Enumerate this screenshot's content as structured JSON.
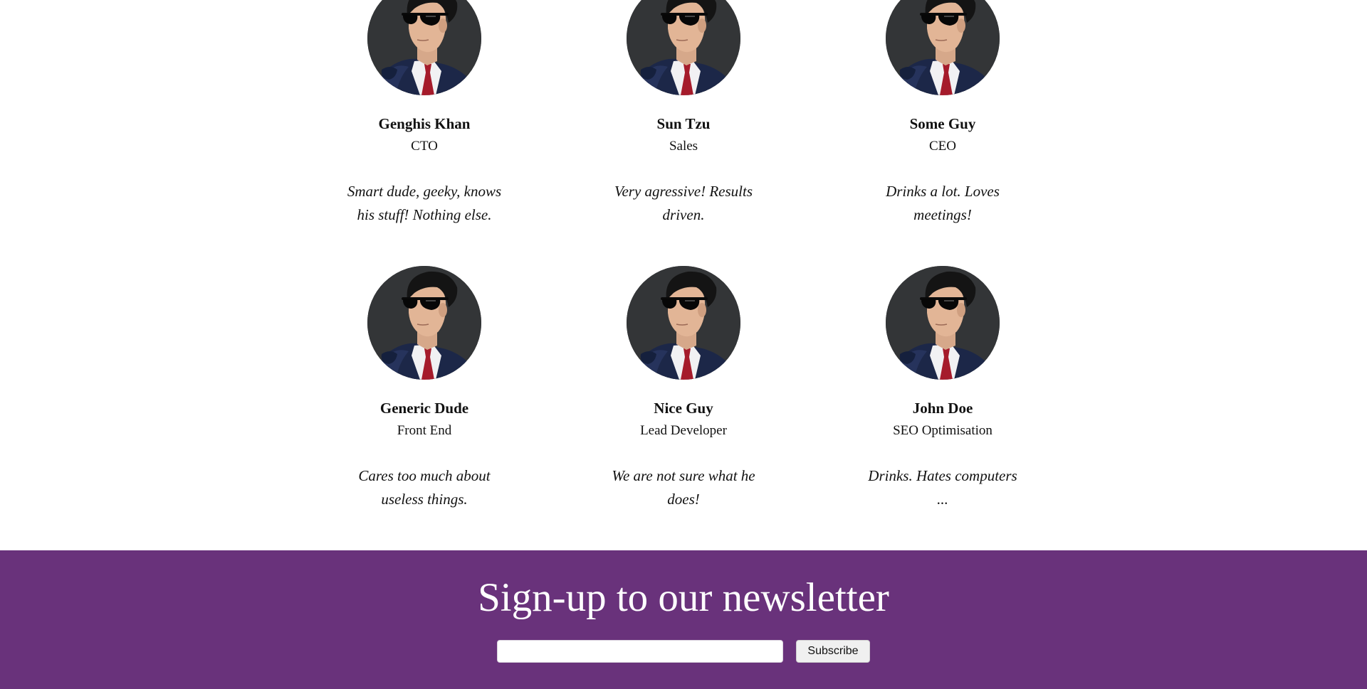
{
  "team": {
    "members": [
      {
        "name": "Genghis Khan",
        "role": "CTO",
        "bio": "Smart dude, geeky, knows his stuff! Nothing else."
      },
      {
        "name": "Sun Tzu",
        "role": "Sales",
        "bio": "Very agressive! Results driven."
      },
      {
        "name": "Some Guy",
        "role": "CEO",
        "bio": "Drinks a lot. Loves meetings!"
      },
      {
        "name": "Generic Dude",
        "role": "Front End",
        "bio": "Cares too much about useless things."
      },
      {
        "name": "Nice Guy",
        "role": "Lead Developer",
        "bio": "We are not sure what he does!"
      },
      {
        "name": "John Doe",
        "role": "SEO Optimisation",
        "bio": "Drinks. Hates computers ..."
      }
    ]
  },
  "newsletter": {
    "title": "Sign-up to our newsletter",
    "email_value": "",
    "button_label": "Subscribe",
    "background_color": "#69327b"
  }
}
